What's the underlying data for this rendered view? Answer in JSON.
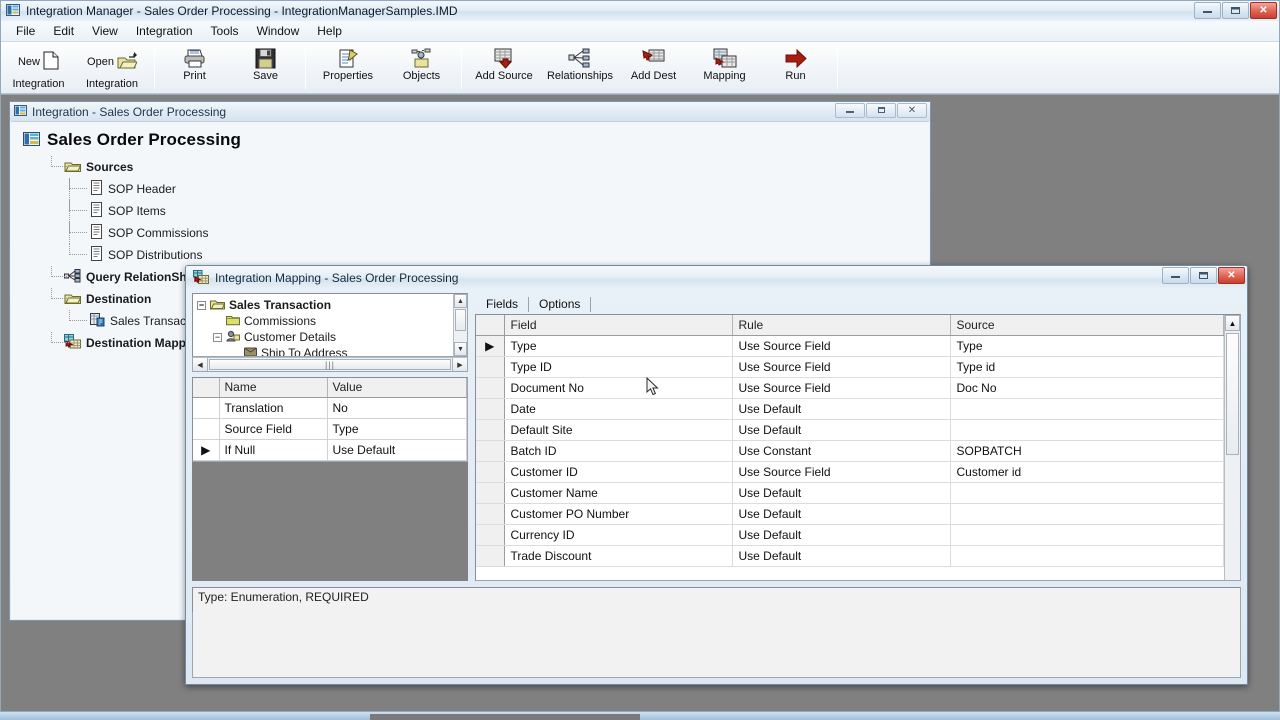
{
  "app": {
    "title": "Integration Manager - Sales Order Processing - IntegrationManagerSamples.IMD",
    "icon": "integration-manager-icon",
    "window_buttons": {
      "minimize": "–",
      "maximize": "□",
      "close": "✕"
    }
  },
  "menu": {
    "items": [
      {
        "label": "File"
      },
      {
        "label": "Edit"
      },
      {
        "label": "View"
      },
      {
        "label": "Integration"
      },
      {
        "label": "Tools"
      },
      {
        "label": "Window"
      },
      {
        "label": "Help"
      }
    ]
  },
  "toolbar": {
    "buttons": [
      {
        "line1": "New",
        "line2": "Integration",
        "icon": "new-document-icon"
      },
      {
        "line1": "Open",
        "line2": "Integration",
        "icon": "open-folder-icon"
      },
      {
        "line1": "Print",
        "line2": "",
        "icon": "printer-icon"
      },
      {
        "line1": "Save",
        "line2": "",
        "icon": "floppy-disk-icon"
      },
      {
        "line1": "Properties",
        "line2": "",
        "icon": "properties-icon"
      },
      {
        "line1": "Objects",
        "line2": "",
        "icon": "objects-icon"
      },
      {
        "line1": "Add Source",
        "line2": "",
        "icon": "add-source-icon"
      },
      {
        "line1": "Relationships",
        "line2": "",
        "icon": "relationships-icon"
      },
      {
        "line1": "Add Dest",
        "line2": "",
        "icon": "add-destination-icon"
      },
      {
        "line1": "Mapping",
        "line2": "",
        "icon": "mapping-icon"
      },
      {
        "line1": "Run",
        "line2": "",
        "icon": "run-arrow-icon"
      }
    ]
  },
  "integration_window": {
    "titlebar": "Integration - Sales Order Processing",
    "heading": "Sales Order Processing",
    "tree": [
      {
        "label": "Sources",
        "icon": "folder-icon",
        "level": 1,
        "bold": true
      },
      {
        "label": "SOP Header",
        "icon": "document-icon",
        "level": 2,
        "bold": false
      },
      {
        "label": "SOP Items",
        "icon": "document-icon",
        "level": 2,
        "bold": false
      },
      {
        "label": "SOP Commissions",
        "icon": "document-icon",
        "level": 2,
        "bold": false
      },
      {
        "label": "SOP Distributions",
        "icon": "document-icon",
        "level": 2,
        "bold": false
      },
      {
        "label": "Query RelationShips",
        "icon": "relationships-icon",
        "level": 1,
        "bold": true
      },
      {
        "label": "Destination",
        "icon": "folder-icon",
        "level": 1,
        "bold": true
      },
      {
        "label": "Sales Transaction",
        "icon": "destination-icon",
        "level": 2,
        "bold": false
      },
      {
        "label": "Destination Mapping",
        "icon": "mapping-icon",
        "level": 1,
        "bold": true
      }
    ]
  },
  "mapping_dialog": {
    "titlebar": "Integration Mapping - Sales Order Processing",
    "tree": [
      {
        "label": "Sales Transaction",
        "expander": "−",
        "icon": "folder-open-icon",
        "indent": 0,
        "bold": true
      },
      {
        "label": "Commissions",
        "expander": "",
        "icon": "folder-icon",
        "indent": 1,
        "bold": false
      },
      {
        "label": "Customer Details",
        "expander": "−",
        "icon": "customer-icon",
        "indent": 1,
        "bold": false
      },
      {
        "label": "Ship To Address",
        "expander": "",
        "icon": "address-icon",
        "indent": 2,
        "bold": false
      }
    ],
    "tree_hscroll_grip": "|||",
    "properties_grid": {
      "columns": [
        "Name",
        "Value"
      ],
      "rows": [
        {
          "marker": "",
          "name": "Translation",
          "value": "No"
        },
        {
          "marker": "",
          "name": "Source Field",
          "value": "Type"
        },
        {
          "marker": "▶",
          "name": "If Null",
          "value": "Use Default"
        }
      ]
    },
    "tabs": [
      {
        "label": "Fields",
        "active": true
      },
      {
        "label": "Options",
        "active": false
      }
    ],
    "fields_grid": {
      "columns": [
        "Field",
        "Rule",
        "Source"
      ],
      "rows": [
        {
          "marker": "▶",
          "field": "Type",
          "rule": "Use Source Field",
          "source": "Type"
        },
        {
          "marker": "",
          "field": "Type ID",
          "rule": "Use Source Field",
          "source": "Type id"
        },
        {
          "marker": "",
          "field": "Document No",
          "rule": "Use Source Field",
          "source": "Doc No"
        },
        {
          "marker": "",
          "field": "Date",
          "rule": "Use Default",
          "source": ""
        },
        {
          "marker": "",
          "field": "Default Site",
          "rule": "Use Default",
          "source": ""
        },
        {
          "marker": "",
          "field": "Batch ID",
          "rule": "Use Constant",
          "source": "SOPBATCH"
        },
        {
          "marker": "",
          "field": "Customer ID",
          "rule": "Use Source Field",
          "source": "Customer id"
        },
        {
          "marker": "",
          "field": "Customer Name",
          "rule": "Use Default",
          "source": ""
        },
        {
          "marker": "",
          "field": "Customer PO Number",
          "rule": "Use Default",
          "source": ""
        },
        {
          "marker": "",
          "field": "Currency ID",
          "rule": "Use Default",
          "source": ""
        },
        {
          "marker": "",
          "field": "Trade Discount",
          "rule": "Use Default",
          "source": ""
        }
      ]
    },
    "status_text": "Type: Enumeration, REQUIRED",
    "window_buttons": {
      "minimize": "–",
      "maximize": "□",
      "close": "✕"
    }
  },
  "colors": {
    "desktop": "#808080",
    "titlebar_accent": "#e6eff7",
    "close_button": "#c8412f",
    "run_arrow": "#a81d12",
    "folder": "#e8e3a0"
  }
}
